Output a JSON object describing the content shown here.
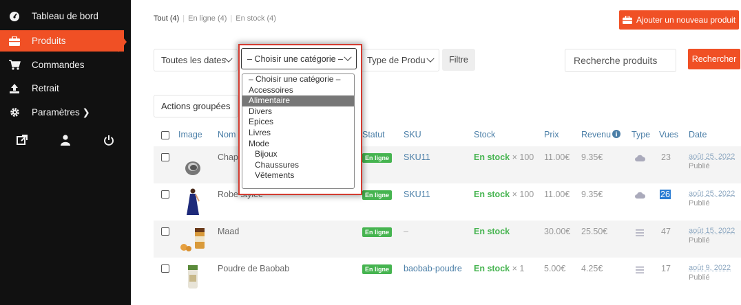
{
  "sidebar": {
    "items": [
      {
        "label": "Tableau de bord",
        "icon": "dashboard-icon"
      },
      {
        "label": "Produits",
        "icon": "briefcase-icon"
      },
      {
        "label": "Commandes",
        "icon": "cart-icon"
      },
      {
        "label": "Retrait",
        "icon": "upload-icon"
      },
      {
        "label": "Paramètres ❯",
        "icon": "gear-icon"
      }
    ],
    "bottom_icons": [
      "external-link-icon",
      "user-icon",
      "power-icon"
    ]
  },
  "header": {
    "tabs": [
      "Tout (4)",
      "En ligne (4)",
      "En stock (4)"
    ],
    "add_button": "Ajouter un nouveau produit"
  },
  "filters": {
    "dates": "Toutes les dates",
    "category": "– Choisir une catégorie –",
    "type": "Type de Produit",
    "filter_button": "Filtre",
    "search_placeholder": "Recherche produits",
    "search_button": "Rechercher",
    "bulk_actions": "Actions groupées"
  },
  "category_options": [
    {
      "label": "– Choisir une catégorie –",
      "indent": false
    },
    {
      "label": "Accessoires",
      "indent": false
    },
    {
      "label": "Alimentaire",
      "indent": false,
      "highlighted": true
    },
    {
      "label": "Divers",
      "indent": false
    },
    {
      "label": "Epices",
      "indent": false
    },
    {
      "label": "Livres",
      "indent": false
    },
    {
      "label": "Mode",
      "indent": false
    },
    {
      "label": "Bijoux",
      "indent": true
    },
    {
      "label": "Chaussures",
      "indent": true
    },
    {
      "label": "Vêtements",
      "indent": true
    }
  ],
  "table": {
    "columns": [
      "Image",
      "Nom",
      "Statut",
      "SKU",
      "Stock",
      "Prix",
      "Revenu",
      "Type",
      "Vues",
      "Date"
    ],
    "rows": [
      {
        "name": "Chapeau",
        "status": "En ligne",
        "sku": "SKU11",
        "stock": "En stock",
        "stock_qty": "× 100",
        "price": "11.00€",
        "revenue": "9.35€",
        "type": "cloud-icon",
        "views": "23",
        "date": "août 25, 2022",
        "state": "Publié"
      },
      {
        "name": "Robe stylée",
        "status": "En ligne",
        "sku": "SKU11",
        "stock": "En stock",
        "stock_qty": "× 100",
        "price": "11.00€",
        "revenue": "9.35€",
        "type": "cloud-icon",
        "views": "26",
        "date": "août 25, 2022",
        "state": "Publié"
      },
      {
        "name": "Maad",
        "status": "En ligne",
        "sku": "–",
        "stock": "En stock",
        "stock_qty": "",
        "price": "30.00€",
        "revenue": "25.50€",
        "type": "list-icon",
        "views": "47",
        "date": "août 15, 2022",
        "state": "Publié"
      },
      {
        "name": "Poudre de Baobab",
        "status": "En ligne",
        "sku": "baobab-poudre",
        "stock": "En stock",
        "stock_qty": "× 1",
        "price": "5.00€",
        "revenue": "4.25€",
        "type": "list-icon",
        "views": "17",
        "date": "août 9, 2022",
        "state": "Publié"
      }
    ]
  },
  "colors": {
    "accent": "#f05025",
    "sidebar": "#111111",
    "online": "#46b450",
    "link": "#4a7ea7"
  }
}
